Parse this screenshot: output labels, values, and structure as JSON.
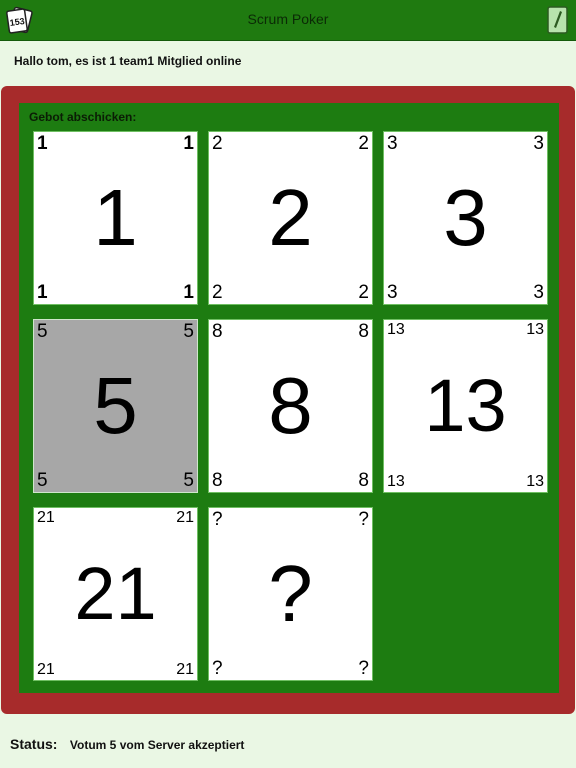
{
  "header": {
    "title": "Scrum Poker",
    "logo_icon": "card-deck-icon",
    "logo_text": "153",
    "menu_icon": "menu-card-icon"
  },
  "greeting": "Hallo tom, es ist 1 team1 Mitglied online",
  "board": {
    "label": "Gebot abschicken:",
    "cards": [
      {
        "value": "1"
      },
      {
        "value": "2"
      },
      {
        "value": "3"
      },
      {
        "value": "5",
        "selected": true
      },
      {
        "value": "8"
      },
      {
        "value": "13"
      },
      {
        "value": "21"
      },
      {
        "value": "?"
      }
    ]
  },
  "status": {
    "label": "Status:",
    "text": "Votum 5 vom Server akzeptiert"
  },
  "colors": {
    "header_bg": "#1f7a10",
    "board_bg": "#1d7c11",
    "frame_bg": "#a72b2b",
    "page_bg": "#eaf7e4",
    "selected_card": "#a7a7a7"
  }
}
